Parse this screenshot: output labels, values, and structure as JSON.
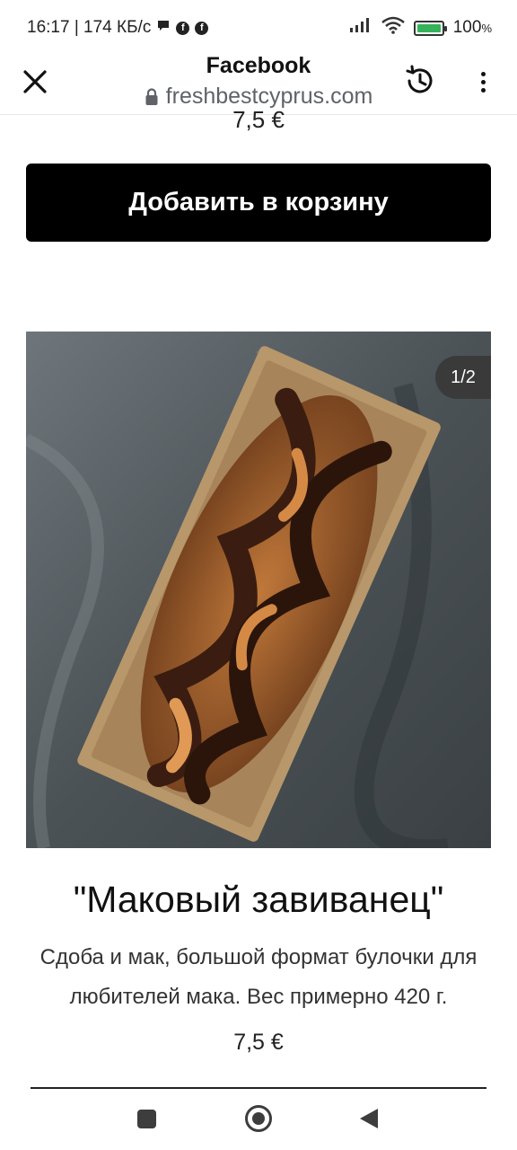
{
  "status_bar": {
    "time_speed": "16:17 | 174 КБ/с",
    "battery_percent": "100",
    "battery_suffix": "%",
    "icons": [
      "chat-bubble-icon",
      "facebook-icon",
      "facebook-icon",
      "signal-icon",
      "wifi-icon",
      "battery-charging-icon"
    ]
  },
  "browser": {
    "title": "Facebook",
    "url": "freshbestcyprus.com",
    "icons": [
      "close-icon",
      "lock-icon",
      "history-icon",
      "more-vert-icon"
    ]
  },
  "previous_item": {
    "price": "7,5 €"
  },
  "cart_button": {
    "label": "Добавить в корзину"
  },
  "product": {
    "image_counter": "1/2",
    "title": "\"Маковый завиванец\"",
    "description": "Сдоба и мак, большой формат булочки для любителей мака. Вес примерно 420 г.",
    "price": "7,5 €"
  },
  "nav_bar": {
    "icons": [
      "recents-icon",
      "home-icon",
      "back-icon"
    ]
  },
  "colors": {
    "button_bg": "#000000",
    "battery_green": "#35b25a",
    "counter_bg": "#3a3a3a"
  }
}
